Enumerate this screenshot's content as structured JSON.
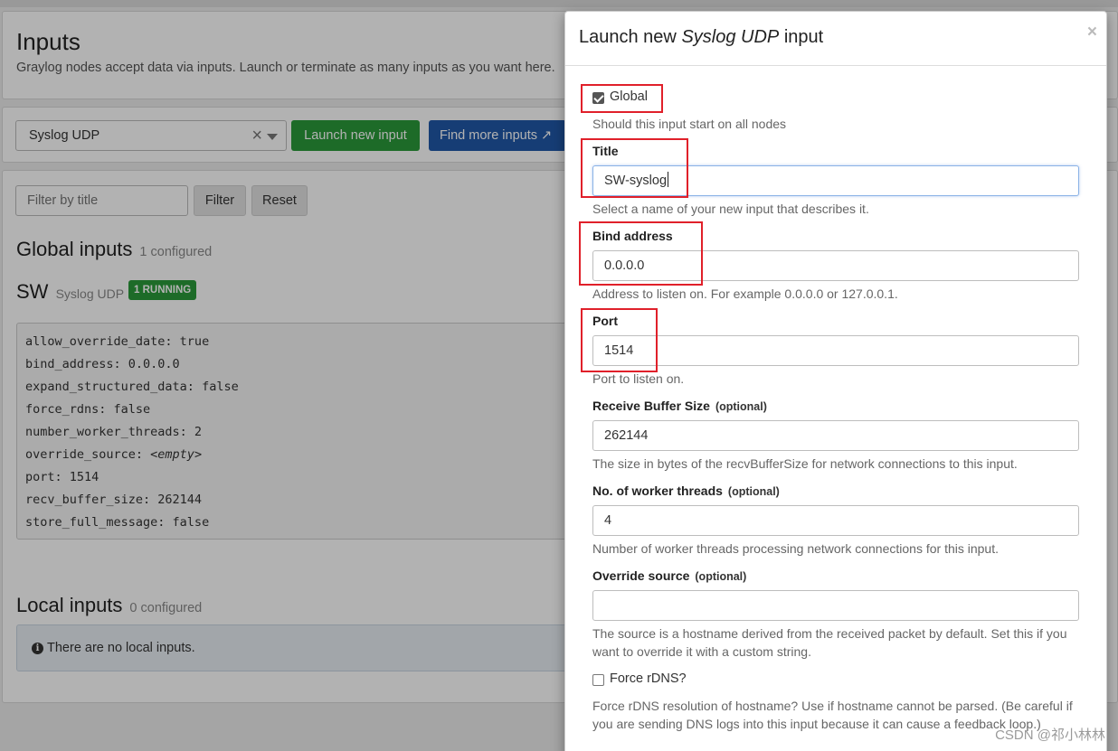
{
  "background": {
    "title": "Inputs",
    "description": "Graylog nodes accept data via inputs. Launch or terminate as many inputs as you want here.",
    "select_value": "Syslog UDP",
    "launch_button": "Launch new input",
    "find_button": "Find more inputs",
    "filter_placeholder": "Filter by title",
    "filter_button": "Filter",
    "reset_button": "Reset",
    "global_inputs": {
      "title": "Global inputs",
      "count": "1 configured"
    },
    "input": {
      "name": "SW",
      "type": "Syslog UDP",
      "status": "1 RUNNING",
      "config": [
        "allow_override_date: true",
        "bind_address: 0.0.0.0",
        "expand_structured_data: false",
        "force_rdns: false",
        "number_worker_threads: 2",
        "override_source: <empty>",
        "port: 1514",
        "recv_buffer_size: 262144",
        "store_full_message: false"
      ]
    },
    "local_inputs": {
      "title": "Local inputs",
      "count": "0 configured"
    },
    "no_local_inputs": "There are no local inputs."
  },
  "modal": {
    "title_prefix": "Launch new",
    "title_type": "Syslog UDP",
    "title_suffix": "input",
    "close": "×",
    "global": {
      "label": "Global",
      "checked": true,
      "help": "Should this input start on all nodes"
    },
    "title_field": {
      "label": "Title",
      "value": "SW-syslog",
      "help": "Select a name of your new input that describes it."
    },
    "bind_address": {
      "label": "Bind address",
      "value": "0.0.0.0",
      "help": "Address to listen on. For example 0.0.0.0 or 127.0.0.1."
    },
    "port": {
      "label": "Port",
      "value": "1514",
      "help": "Port to listen on."
    },
    "recv_buffer": {
      "label": "Receive Buffer Size",
      "optional": "(optional)",
      "value": "262144",
      "help": "The size in bytes of the recvBufferSize for network connections to this input."
    },
    "worker_threads": {
      "label": "No. of worker threads",
      "optional": "(optional)",
      "value": "4",
      "help": "Number of worker threads processing network connections for this input."
    },
    "override_source": {
      "label": "Override source",
      "optional": "(optional)",
      "value": "",
      "help": "The source is a hostname derived from the received packet by default. Set this if you want to override it with a custom string."
    },
    "force_rdns": {
      "label": "Force rDNS?",
      "checked": false,
      "help": "Force rDNS resolution of hostname? Use if hostname cannot be parsed. (Be careful if you are sending DNS logs into this input because it can cause a feedback loop.)"
    }
  },
  "watermark": "CSDN @祁小林林",
  "colors": {
    "annotation": "#e0202a",
    "success": "#2a9a3a",
    "primary": "#2058a8"
  }
}
